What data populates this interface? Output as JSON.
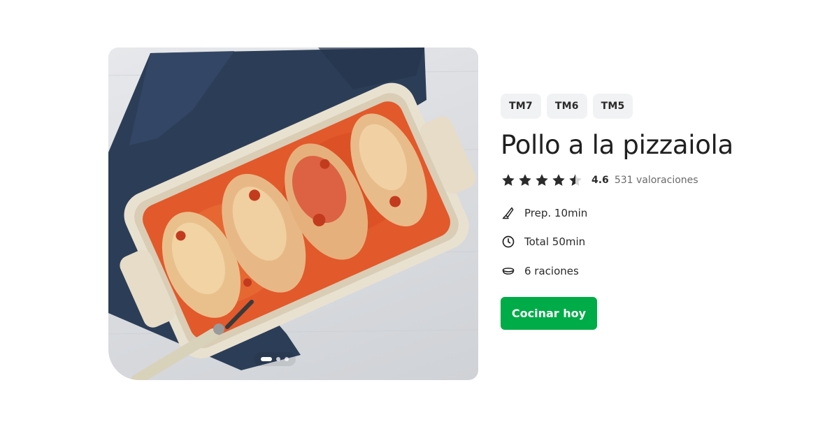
{
  "recipe": {
    "thermomix_models": [
      "TM7",
      "TM6",
      "TM5"
    ],
    "title": "Pollo a la pizzaiola",
    "rating": {
      "stars_filled": 4.6,
      "stars_max": 5,
      "value": "4.6",
      "count_label": "531 valoraciones"
    },
    "meta": {
      "prep": {
        "icon": "knife-icon",
        "label": "Prep. 10min"
      },
      "total": {
        "icon": "clock-icon",
        "label": "Total 50min"
      },
      "servings": {
        "icon": "bowl-icon",
        "label": "6 raciones"
      }
    },
    "cta_label": "Cocinar hoy"
  },
  "gallery": {
    "slide_count": 3,
    "active_slide": 1
  },
  "colors": {
    "cta": "#00ac47",
    "badge_bg": "#f1f2f3",
    "star": "#2b2b2b"
  }
}
